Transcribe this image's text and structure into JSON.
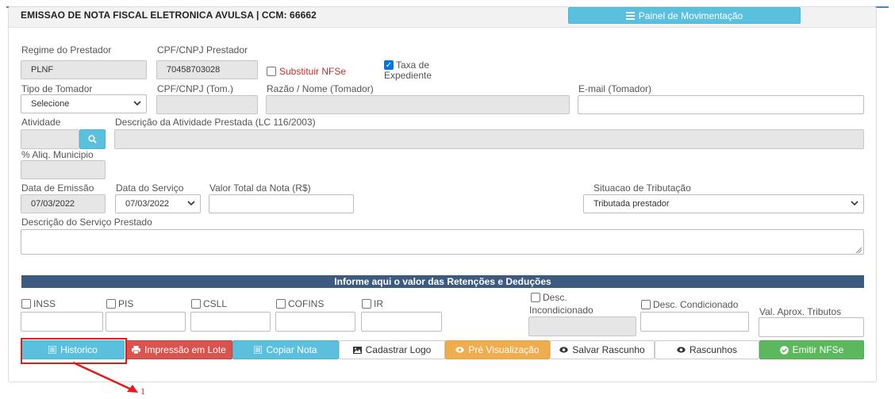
{
  "header": {
    "title": "EMISSAO DE NOTA FISCAL ELETRONICA AVULSA | CCM: 66662",
    "painel_label": "Painel de Movimentação"
  },
  "prestador": {
    "regime_label": "Regime do Prestador",
    "regime_value": "PLNF",
    "cpf_label": "CPF/CNPJ Prestador",
    "cpf_value": "70458703028",
    "substituir_label": "Substituir NFSe",
    "taxa_label_1": "Taxa de",
    "taxa_label_2": "Expediente"
  },
  "tomador": {
    "tipo_label": "Tipo de Tomador",
    "tipo_value": "Selecione",
    "cpf_label": "CPF/CNPJ (Tom.)",
    "razao_label": "Razão / Nome (Tomador)",
    "email_label": "E-mail (Tomador)"
  },
  "atividade": {
    "atividade_label": "Atividade",
    "descricao_label": "Descrição da Atividade Prestada (LC 116/2003)",
    "aliq_label": "% Aliq. Municipio"
  },
  "servico": {
    "data_emissao_label": "Data de Emissão",
    "data_emissao_value": "07/03/2022",
    "data_servico_label": "Data do Serviço",
    "data_servico_value": "07/03/2022",
    "valor_total_label": "Valor Total da Nota (R$)",
    "situacao_label": "Situacao de Tributação",
    "situacao_value": "Tributada prestador",
    "descricao_servico_label": "Descrição do Serviço Prestado"
  },
  "retencoes": {
    "bar_label": "Informe aqui o valor das Retenções e Deduções",
    "inss": "INSS",
    "pis": "PIS",
    "csll": "CSLL",
    "cofins": "COFINS",
    "ir": "IR",
    "desc_incond_1": "Desc.",
    "desc_incond_2": "Incondicionado",
    "desc_cond": "Desc. Condicionado",
    "val_aprox": "Val. Aprox. Tributos"
  },
  "actions": {
    "historico": "Historico",
    "impressao": "Impressão em Lote",
    "copiar": "Copiar Nota",
    "cadastrar_logo": "Cadastrar Logo",
    "pre_visualizacao": "Pré Visualização",
    "salvar_rascunho": "Salvar Rascunho",
    "rascunhos": "Rascunhos",
    "emitir": "Emitir NFSe"
  },
  "annotation": {
    "number": "1",
    "color": "#e21b1b"
  },
  "colors": {
    "info": "#5bc0de",
    "danger": "#d9534f",
    "warning": "#f0ad4e",
    "success": "#5cb85c",
    "bar": "#3d5a80"
  }
}
